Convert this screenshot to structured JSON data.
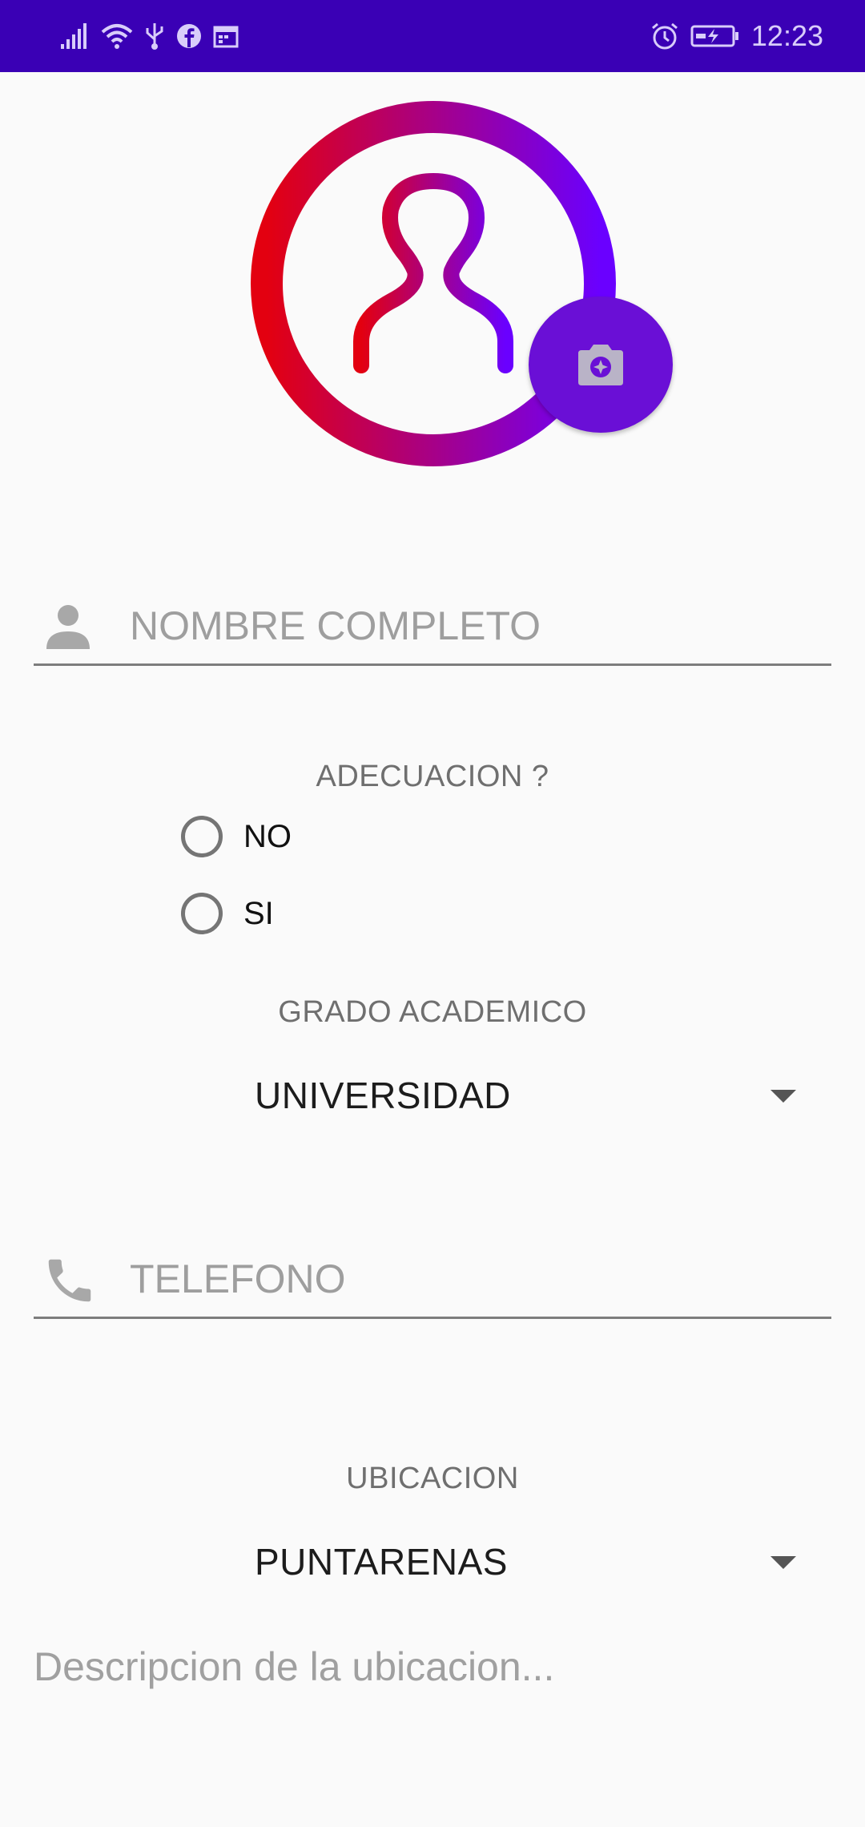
{
  "status_bar": {
    "time": "12:23",
    "left_icons": [
      "signal-icon",
      "wifi-icon",
      "usb-icon",
      "facebook-icon",
      "calendar-icon"
    ],
    "right_icons": [
      "alarm-icon",
      "battery-charging-icon"
    ],
    "background_color": "#3a00b5"
  },
  "profile": {
    "avatar_icon": "user-avatar-icon",
    "camera_icon": "camera-icon",
    "gradient_colors": [
      "#e30010",
      "#6a00ff"
    ],
    "camera_button_color": "#6a0fd6"
  },
  "form": {
    "full_name": {
      "icon": "person-icon",
      "placeholder": "NOMBRE COMPLETO",
      "value": ""
    },
    "adecuacion": {
      "label": "ADECUACION ?",
      "options": [
        "NO",
        "SI"
      ],
      "selected": null
    },
    "grado_academico": {
      "label": "GRADO ACADEMICO",
      "selected": "UNIVERSIDAD"
    },
    "telefono": {
      "icon": "phone-icon",
      "placeholder": "TELEFONO",
      "value": ""
    },
    "ubicacion": {
      "label": "UBICACION",
      "selected": "PUNTARENAS"
    },
    "descripcion": {
      "placeholder": "Descripcion de la ubicacion...",
      "value": ""
    }
  }
}
